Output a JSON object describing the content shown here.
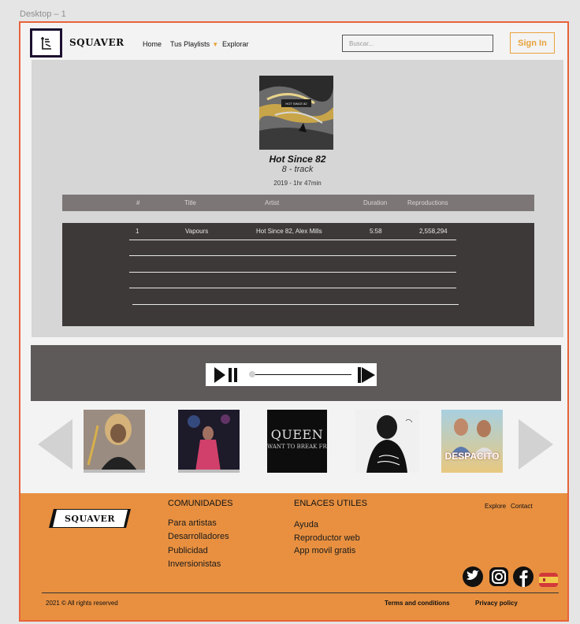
{
  "frame_label": "Desktop – 1",
  "header": {
    "brand": "SQUAVER",
    "nav": [
      {
        "label": "Home"
      },
      {
        "label": "Tus Playlists",
        "caret": "▼"
      },
      {
        "label": "Explorar"
      }
    ],
    "search_placeholder": "Buscar...",
    "signin_label": "Sign In"
  },
  "album": {
    "title": "Hot Since 82",
    "subtitle": "8 - track",
    "meta": "2019 - 1hr 47min",
    "columns": [
      "#",
      "Title",
      "Artist",
      "Duration",
      "Reproductions"
    ],
    "tracks": [
      {
        "num": "1",
        "title": "Vapours",
        "artist": "Hot Since 82, Alex Mills",
        "duration": "5:58",
        "plays": "2,558,294"
      }
    ],
    "cover_text": "HOT SINCE 82"
  },
  "player": {
    "progress": 0.0,
    "play_pause_icon": "play-pause-icon",
    "next_icon": "skip-next-icon"
  },
  "carousel": {
    "items": [
      {
        "name": "album-cover-1",
        "text": ""
      },
      {
        "name": "album-cover-2",
        "text": ""
      },
      {
        "name": "album-cover-queen",
        "text": "QUEEN",
        "subtext": "WANT TO BREAK FRE"
      },
      {
        "name": "album-cover-4",
        "text": ""
      },
      {
        "name": "album-cover-despacito",
        "text": "DESPACITO"
      }
    ]
  },
  "footer": {
    "brand": "SQUAVER",
    "comunidades": {
      "heading": "COMUNIDADES",
      "links": [
        "Para artistas",
        "Desarrolladores",
        "Publicidad",
        "Inversionistas"
      ]
    },
    "enlaces": {
      "heading": "ENLACES UTILES",
      "links": [
        "Ayuda",
        "Reproductor web",
        "App movil gratis"
      ]
    },
    "explore": "Explore",
    "contact": "Contact",
    "copyright": "2021 © All rights reserved",
    "terms": "Terms and conditions",
    "privacy": "Privacy policy",
    "social_icons": [
      "twitter-icon",
      "instagram-icon",
      "facebook-icon",
      "spain-flag-icon"
    ]
  },
  "colors": {
    "accent": "#e8623a",
    "signin": "#e8a23a",
    "footer_bg": "#e89040",
    "table_body": "#3d3938"
  }
}
